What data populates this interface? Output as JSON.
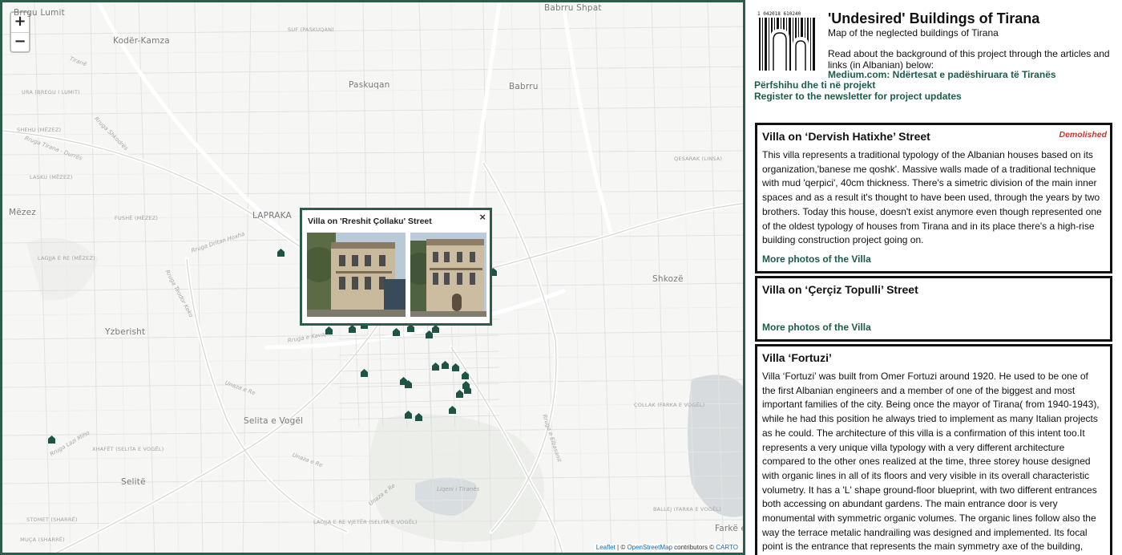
{
  "map": {
    "zoom_in": "+",
    "zoom_out": "−",
    "places": [
      {
        "text": "Brrgu Lumit",
        "cls": "big"
      },
      {
        "text": "Kodër-Kamza",
        "cls": "big"
      },
      {
        "text": "Paskuqan",
        "cls": "big"
      },
      {
        "text": "Babrru",
        "cls": "big"
      },
      {
        "text": "Babrru Shpat",
        "cls": "big"
      },
      {
        "text": "Mëzez",
        "cls": "big"
      },
      {
        "text": "LAPRAKA",
        "cls": "big"
      },
      {
        "text": "Yzberisht",
        "cls": "big"
      },
      {
        "text": "Shkozë",
        "cls": "big"
      },
      {
        "text": "Selita e Vogël",
        "cls": "big"
      },
      {
        "text": "Selitë",
        "cls": "big"
      },
      {
        "text": "Farkë e",
        "cls": "big"
      },
      {
        "text": "SUF (PASKUQAN)",
        "cls": "small"
      },
      {
        "text": "URA (BREGU I LUMIT)",
        "cls": "small"
      },
      {
        "text": "SHEHU (MËZEZ)",
        "cls": "small"
      },
      {
        "text": "LASKU (MËZEZ)",
        "cls": "small"
      },
      {
        "text": "FUSHË (MËZEZ)",
        "cls": "small"
      },
      {
        "text": "LAGJJA E RE (MËZEZ)",
        "cls": "small"
      },
      {
        "text": "QESARAK (LINSA)",
        "cls": "small"
      },
      {
        "text": "ÇOLLAK (FARKA E VOGËL)",
        "cls": "small"
      },
      {
        "text": "XHAFËT (SELITA E VOGËL)",
        "cls": "small"
      },
      {
        "text": "STOMET (SHARRË)",
        "cls": "small"
      },
      {
        "text": "MUÇA (SHARRË)",
        "cls": "small"
      },
      {
        "text": "LAGJJA E RE VJETËR (SELITA E VOGËL)",
        "cls": "small"
      },
      {
        "text": "BALLEJ (FARKA E VOGËL)",
        "cls": "small"
      }
    ],
    "streets": [
      "Rruga Dritan Hoxha",
      "Rruga Teodor Keko",
      "Unaza e Re",
      "Unaza e Re",
      "Rruga Lazi Miho",
      "Liqeni i Tiranës",
      "Rruga Shkodrës",
      "Rruga e Kavajës",
      "Rruga Tirana - Durrës",
      "Tiranë",
      "Rruga e Elbasanit",
      "Unaza e Re"
    ],
    "marker_color": "#1e5446",
    "popup": {
      "title": "Villa on 'Rreshit Çollaku' Street",
      "close": "×"
    },
    "attribution": {
      "leaflet": "Leaflet",
      "sep": " | © ",
      "osm": "OpenStreetMap",
      "contributors": " contributors © ",
      "carto": "CARTO"
    }
  },
  "sidebar": {
    "title": "'Undesired' Buildings of Tirana",
    "subtitle": "Map of the neglected buildings of Tirana",
    "intro": "Read about the background of this project through the articles and links (in Albanian) below:",
    "links": [
      "Medium.com: Ndërtesat e padëshiruara të Tiranës",
      "Përfshihu dhe ti në projekt",
      "Register to the newsletter for project updates"
    ],
    "logo_text": "1 042018 610240"
  },
  "cards": [
    {
      "title": "Villa on ‘Dervish Hatixhe’ Street",
      "status": "Demolished",
      "desc": "This villa represents a traditional typology of the Albanian houses based on its organization,'banese me qoshk'. Massive walls made of a traditional technique with mud 'qerpici', 40cm thickness. There's a simetric division of the main inner spaces and as a result it's thought to have been used, through the years by two brothers. Today this house, doesn't exist anymore even though represented one of the oldest typology of houses from Tirana and in its place there's a high-rise building construction project going on.",
      "more": "More photos of the Villa"
    },
    {
      "title": "Villa on ‘Çerçiz Topulli’ Street",
      "status": "",
      "desc": "",
      "more": "More photos of the Villa"
    },
    {
      "title": "Villa ‘Fortuzi’",
      "status": "",
      "desc": "Villa ‘Fortuzi’ was built from Omer Fortuzi around 1920. He used to be one of the first Albanian engineers and a member of one of the biggest and most important families of the city. Being once the mayor of Tirana( from 1940-1943), while he had this position he always tried to implement as many Italian projects as he could. The architecture of this villa is a confirmation of this intent too.It represents a very unique villa typology with a very different architecture compared to the other ones realized at the time, three storey house designed with organic lines in all of its floors and very visible in its overall characteristic volumetry. It has a 'L' shape ground-floor blueprint, with two different entrances both accessing on abundant gardens. The main entrance door is very monumental with symmetric organic volumes. The organic lines follow also the way the terrace metalic handrailing was designed and implemented. Its focal point is the entrance that represents the main symmetry axe of the building, composed with three, 2 storey",
      "more": ""
    }
  ]
}
